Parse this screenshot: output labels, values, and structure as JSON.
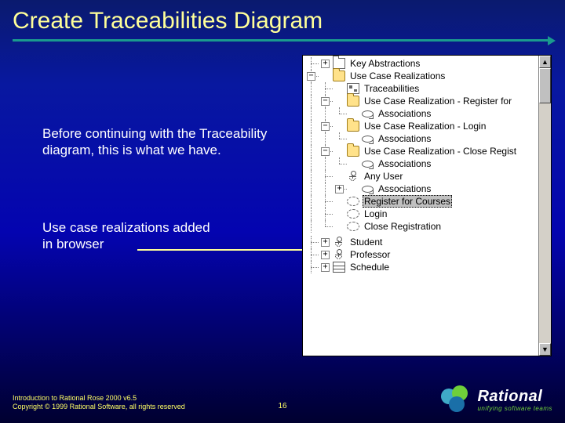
{
  "title": "Create Traceabilities Diagram",
  "body1": "Before continuing with the Traceability diagram, this is what we have.",
  "body2": "Use case realizations added  in browser",
  "tree": {
    "n0": "Key Abstractions",
    "n1": "Use Case Realizations",
    "n2": "Traceabilities",
    "n3": "Use Case Realization - Register for",
    "n4": "Associations",
    "n5": "Use Case Realization - Login",
    "n6": "Associations",
    "n7": "Use Case Realization - Close Regist",
    "n8": "Associations",
    "n9": "Any User",
    "n10": "Associations",
    "n11": "Register for Courses",
    "n12": "Login",
    "n13": "Close Registration",
    "n14": "Student",
    "n15": "Professor",
    "n16": "Schedule"
  },
  "footer": {
    "line1": "Introduction to Rational Rose 2000 v6.5",
    "line2": "Copyright © 1999 Rational Software, all rights reserved",
    "page": "16"
  },
  "logo": {
    "name": "Rational",
    "tag": "unifying software teams"
  }
}
